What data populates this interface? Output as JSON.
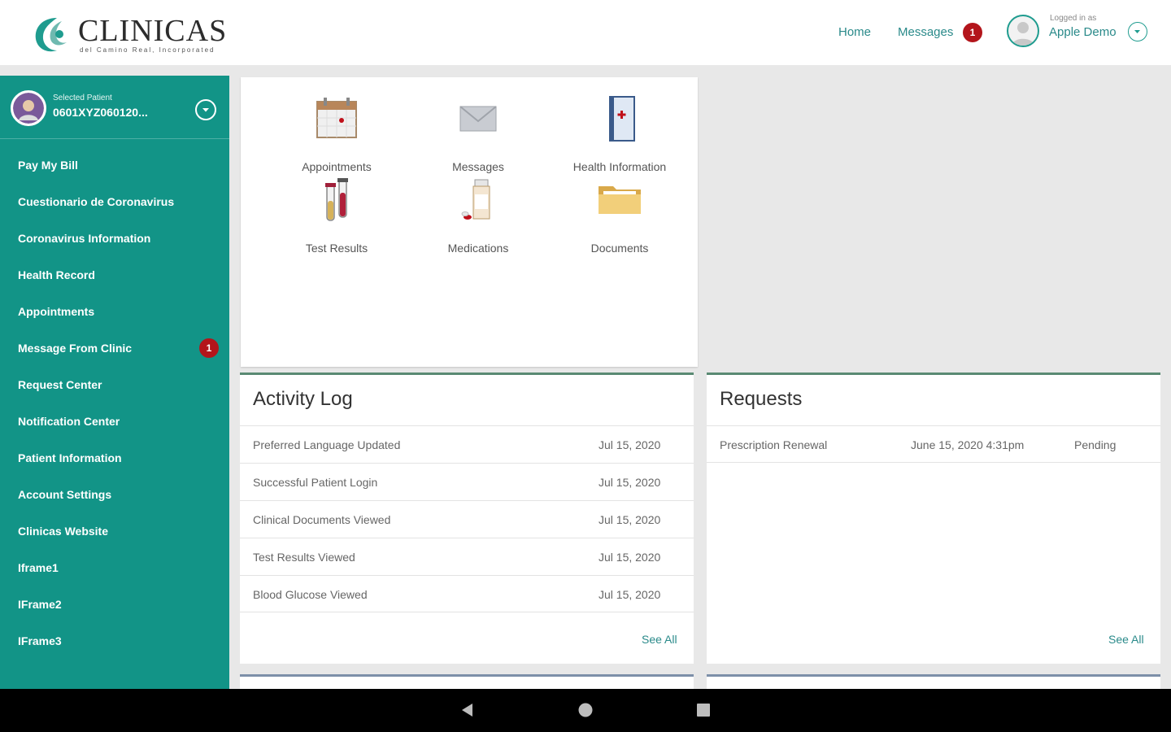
{
  "header": {
    "logo_text": "Clinicas",
    "logo_subtitle": "del Camino Real, Incorporated",
    "nav_home": "Home",
    "nav_messages": "Messages",
    "messages_count": "1",
    "logged_in_label": "Logged in as",
    "logged_in_user": "Apple Demo"
  },
  "sidebar": {
    "selected_patient_label": "Selected Patient",
    "patient_id": "0601XYZ060120...",
    "items": [
      {
        "label": "Pay My Bill"
      },
      {
        "label": "Cuestionario de Coronavirus"
      },
      {
        "label": "Coronavirus Information"
      },
      {
        "label": "Health Record"
      },
      {
        "label": "Appointments"
      },
      {
        "label": "Message From Clinic",
        "badge": "1"
      },
      {
        "label": "Request Center"
      },
      {
        "label": "Notification Center"
      },
      {
        "label": "Patient Information"
      },
      {
        "label": "Account Settings"
      },
      {
        "label": "Clinicas Website"
      },
      {
        "label": "Iframe1"
      },
      {
        "label": "IFrame2"
      },
      {
        "label": "IFrame3"
      }
    ]
  },
  "tiles": [
    {
      "label": "Appointments",
      "icon": "calendar-icon"
    },
    {
      "label": "Messages",
      "icon": "envelope-icon"
    },
    {
      "label": "Health Information",
      "icon": "health-booklet-icon"
    },
    {
      "label": "Test Results",
      "icon": "test-tubes-icon"
    },
    {
      "label": "Medications",
      "icon": "pill-bottle-icon"
    },
    {
      "label": "Documents",
      "icon": "folder-icon"
    }
  ],
  "activity_log": {
    "title": "Activity Log",
    "rows": [
      {
        "event": "Preferred Language Updated",
        "date": "Jul 15, 2020"
      },
      {
        "event": "Successful Patient Login",
        "date": "Jul 15, 2020"
      },
      {
        "event": "Clinical Documents Viewed",
        "date": "Jul 15, 2020"
      },
      {
        "event": "Test Results Viewed",
        "date": "Jul 15, 2020"
      },
      {
        "event": "Blood Glucose Viewed",
        "date": "Jul 15, 2020"
      }
    ],
    "see_all": "See All"
  },
  "requests": {
    "title": "Requests",
    "rows": [
      {
        "type": "Prescription Renewal",
        "date": "June 15, 2020 4:31pm",
        "status": "Pending"
      }
    ],
    "see_all": "See All"
  },
  "colors": {
    "sidebar": "#129487",
    "accent": "#1f9c8f",
    "badge": "#b3151b"
  }
}
